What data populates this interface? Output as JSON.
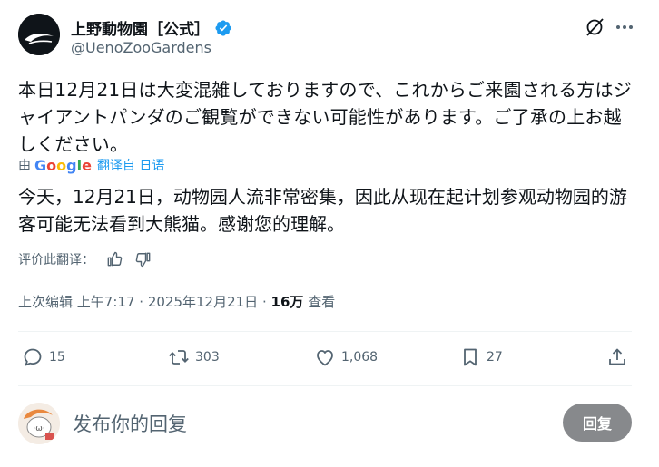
{
  "author": {
    "name": "上野動物園［公式］",
    "handle": "@UenoZooGardens"
  },
  "tweet": {
    "text": "本日12月21日は大変混雑しておりますので、これからご来園される方はジャイアントパンダのご観覧ができない可能性があります。ご了承の上お越しください。"
  },
  "translation": {
    "by_prefix": "由",
    "google_brand": "Google",
    "link_label": "翻译自 日语",
    "text": "今天，12月21日，动物园人流非常密集，因此从现在起计划参观动物园的游客可能无法看到大熊猫。感谢您的理解。",
    "rate_label": "评价此翻译："
  },
  "meta": {
    "edited_label": "上次编辑",
    "time": "上午7:17",
    "separator": "·",
    "date": "2025年12月21日",
    "views_count": "16万",
    "views_label": "查看"
  },
  "actions": {
    "replies": "15",
    "reposts": "303",
    "likes": "1,068",
    "bookmarks": "27"
  },
  "reply": {
    "placeholder": "发布你的回复",
    "button_label": "回复"
  },
  "colors": {
    "accent": "#1d9bf0",
    "secondary_text": "#536471",
    "reply_button_disabled": "#87898c"
  },
  "icons": [
    "verified-badge-icon",
    "grok-icon",
    "more-icon",
    "thumbs-up-icon",
    "thumbs-down-icon",
    "reply-icon",
    "repost-icon",
    "like-icon",
    "bookmark-icon",
    "share-icon"
  ]
}
